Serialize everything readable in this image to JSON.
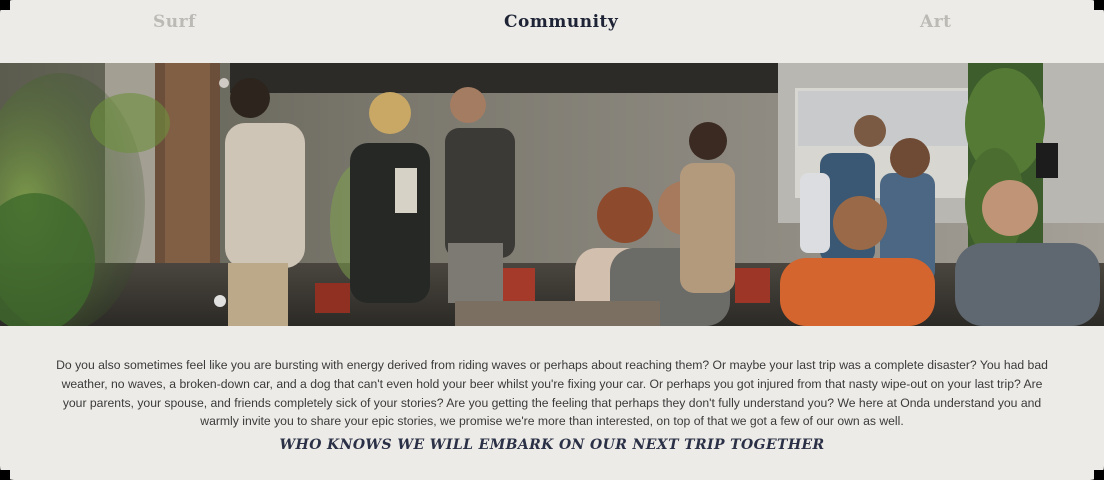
{
  "nav": {
    "items": [
      {
        "label": "Surf",
        "state": "inactive"
      },
      {
        "label": "Community",
        "state": "active"
      },
      {
        "label": "Art",
        "state": "inactive"
      }
    ]
  },
  "hero": {
    "description": "Photo of a group of people socializing at an indoor/outdoor venue with plants and a projection screen"
  },
  "content": {
    "paragraph": "Do you also sometimes feel like you are bursting with energy derived from riding waves or perhaps about reaching them? Or maybe your last trip was a complete disaster? You had bad weather, no waves, a broken-down car, and a dog that can't even hold your beer whilst you're fixing your car. Or perhaps you got injured from that nasty wipe-out on your last trip? Are your parents, your spouse, and friends completely sick of your stories? Are you getting the feeling that perhaps they don't fully understand you? We here at Onda understand you and warmly invite you to share your epic stories, we promise we're more than interested, on top of that we got a few of our own as well.",
    "tagline": "WHO KNOWS WE WILL EMBARK ON OUR NEXT TRIP TOGETHER"
  },
  "colors": {
    "background": "#edebe7",
    "nav_active": "#1e2436",
    "nav_inactive": "#bcbab5",
    "text": "#3a3a3a",
    "tagline": "#2a3046"
  }
}
